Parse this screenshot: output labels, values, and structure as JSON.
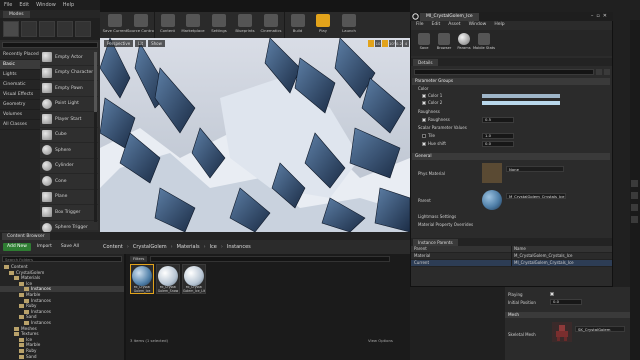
{
  "menu": [
    "File",
    "Edit",
    "Window",
    "Help"
  ],
  "modes_tab": "Modes",
  "place": {
    "categories": [
      "Recently Placed",
      "Basic",
      "Lights",
      "Cinematic",
      "Visual Effects",
      "Geometry",
      "Volumes",
      "All Classes"
    ],
    "selected_category": "Basic",
    "items": [
      "Empty Actor",
      "Empty Character",
      "Empty Pawn",
      "Point Light",
      "Player Start",
      "Cube",
      "Sphere",
      "Cylinder",
      "Cone",
      "Plane",
      "Box Trigger",
      "Sphere Trigger"
    ]
  },
  "toolbar": [
    "Save Current",
    "Source Control",
    "Content",
    "Marketplace",
    "Settings",
    "Blueprints",
    "Cinematics",
    "Build",
    "Play",
    "Launch"
  ],
  "viewport": {
    "buttons": [
      "Perspective",
      "Lit",
      "Show"
    ],
    "right_controls": [
      "10",
      "10°",
      "0.25",
      "4"
    ]
  },
  "content_browser": {
    "tab": "Content Browser",
    "add_new": "Add New",
    "import": "Import",
    "save_all": "Save All",
    "breadcrumbs": [
      "Content",
      "CrystalGolem",
      "Materials",
      "Ice",
      "Instances"
    ],
    "search_folders": "Search Folders",
    "filters": "Filters",
    "tree": [
      {
        "label": "Content",
        "indent": 0,
        "sel": false
      },
      {
        "label": "CrystalGolem",
        "indent": 1,
        "sel": false
      },
      {
        "label": "Materials",
        "indent": 2,
        "sel": false
      },
      {
        "label": "Ice",
        "indent": 3,
        "sel": false
      },
      {
        "label": "Instances",
        "indent": 4,
        "sel": true
      },
      {
        "label": "Marble",
        "indent": 3,
        "sel": false
      },
      {
        "label": "Instances",
        "indent": 4,
        "sel": false
      },
      {
        "label": "Ruby",
        "indent": 3,
        "sel": false
      },
      {
        "label": "Instances",
        "indent": 4,
        "sel": false
      },
      {
        "label": "Sand",
        "indent": 3,
        "sel": false
      },
      {
        "label": "Instances",
        "indent": 4,
        "sel": false
      },
      {
        "label": "Meshes",
        "indent": 2,
        "sel": false
      },
      {
        "label": "Textures",
        "indent": 2,
        "sel": false
      },
      {
        "label": "Ice",
        "indent": 3,
        "sel": false
      },
      {
        "label": "Marble",
        "indent": 3,
        "sel": false
      },
      {
        "label": "Ruby",
        "indent": 3,
        "sel": false
      },
      {
        "label": "Sand",
        "indent": 3,
        "sel": false
      }
    ],
    "assets": [
      {
        "name": "MI_Crystal Golem_Ice",
        "selected": true
      },
      {
        "name": "MI_Crystal Golem_Snow",
        "selected": false
      },
      {
        "name": "MI_Crystal Golem_Ice_Lite",
        "selected": false
      }
    ],
    "status": "3 items (1 selected)",
    "view_options": "View Options"
  },
  "mi_editor": {
    "tab": "MI_CrystalGolem_Ice",
    "menu": [
      "File",
      "Edit",
      "Asset",
      "Window",
      "Help"
    ],
    "tools": [
      "Save",
      "Browser",
      "Params",
      "Mobile Stats"
    ],
    "details_tab": "Details",
    "sections": {
      "parameter_groups": "Parameter Groups",
      "color": "Color",
      "roughness": "Roughness",
      "scalar": "Scalar Parameter Values",
      "general": "General"
    },
    "params": {
      "color1": "Color 1",
      "color2": "Color 2",
      "roughness": "Roughness",
      "roughness_value": "0.5",
      "tile": "Tile",
      "tile_value": "1.0",
      "hue_shift": "Hue shift",
      "hue_shift_value": "0.0"
    },
    "general": {
      "phys_material": "Phys Material",
      "phys_value": "None",
      "parent": "Parent",
      "parent_value": "M_CrystalGolem_Crystals_Ice",
      "lightmass": "Lightmass Settings",
      "overrides": "Material Property Overrides"
    },
    "instance_parents": {
      "tab": "Instance Parents",
      "headers": [
        "Parent",
        "Name"
      ],
      "rows": [
        [
          "Material",
          "M_CrystalGolem_Crystals_Ice"
        ],
        [
          "Current",
          "MI_CrystalGolem_Crystals_Ice"
        ]
      ]
    }
  },
  "right_details": {
    "playing": "Playing",
    "initial_position": "Initial Position",
    "initial_position_value": "0.0",
    "mesh_section": "Mesh",
    "skeletal_mesh": "Skeletal Mesh",
    "skeletal_value": "SK_CrystalGolem"
  },
  "colors": {
    "accent": "#e2a31b",
    "add_new": "#2e7d32",
    "ice_sphere": "#4f7fa8",
    "color1_bar": "#9fb6c9",
    "color2_bar": "#b9d8ec"
  }
}
